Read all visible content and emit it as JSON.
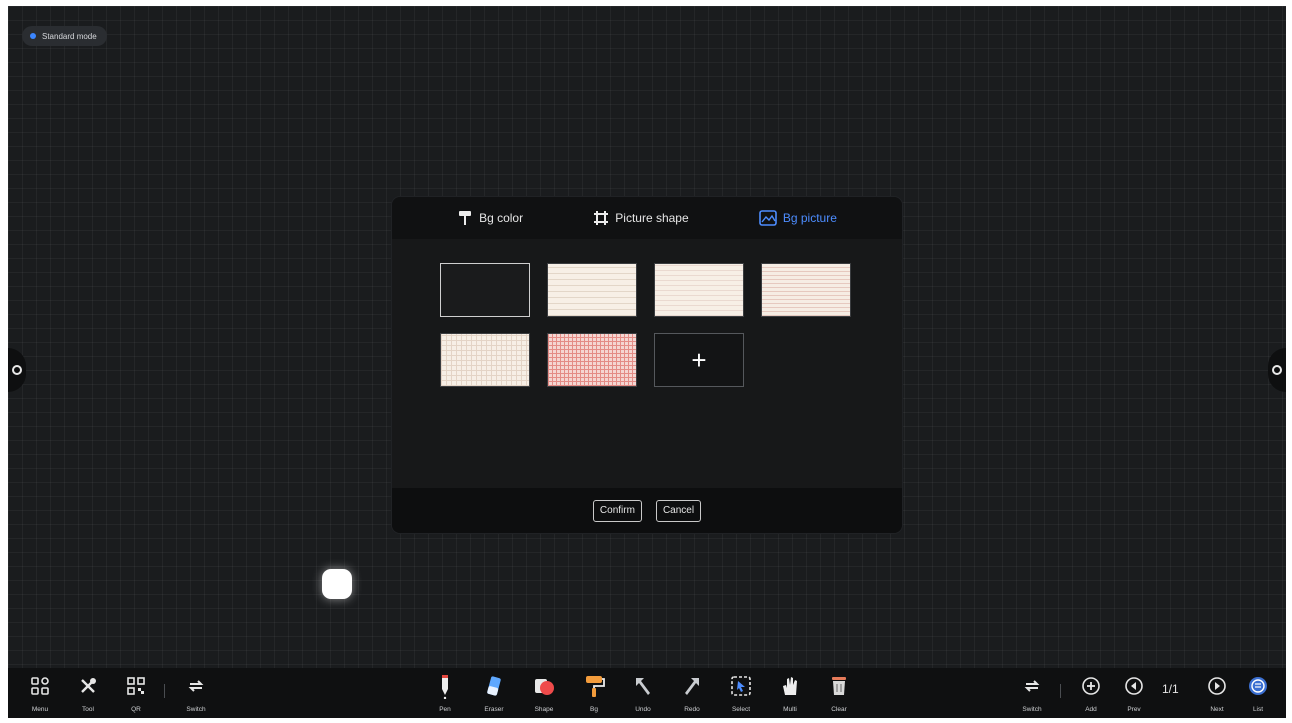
{
  "mode": {
    "label": "Standard mode"
  },
  "dialog": {
    "tabs": [
      {
        "label": "Bg color",
        "icon": "paint-roller-icon",
        "active": false
      },
      {
        "label": "Picture shape",
        "icon": "crop-frame-icon",
        "active": false
      },
      {
        "label": "Bg picture",
        "icon": "image-icon",
        "active": true
      }
    ],
    "backgrounds": [
      {
        "name": "dark-plain",
        "selected": true
      },
      {
        "name": "beige-lined",
        "selected": false
      },
      {
        "name": "beige-lined-fine",
        "selected": false
      },
      {
        "name": "beige-lined-red",
        "selected": false
      },
      {
        "name": "beige-grid",
        "selected": false
      },
      {
        "name": "pink-grid",
        "selected": false
      }
    ],
    "add_symbol": "+",
    "confirm_label": "Confirm",
    "cancel_label": "Cancel"
  },
  "toolbar": {
    "left": [
      {
        "label": "Menu",
        "icon": "menu-grid-icon"
      },
      {
        "label": "Tool",
        "icon": "tools-icon"
      },
      {
        "label": "QR",
        "icon": "qr-code-icon"
      },
      {
        "label": "Switch",
        "icon": "switch-icon"
      }
    ],
    "center": [
      {
        "label": "Pen",
        "icon": "pen-icon"
      },
      {
        "label": "Eraser",
        "icon": "eraser-icon"
      },
      {
        "label": "Shape",
        "icon": "shape-icon"
      },
      {
        "label": "Bg",
        "icon": "paint-roller-icon"
      },
      {
        "label": "Undo",
        "icon": "undo-icon"
      },
      {
        "label": "Redo",
        "icon": "redo-icon"
      },
      {
        "label": "Select",
        "icon": "select-icon"
      },
      {
        "label": "Multi",
        "icon": "multi-touch-icon"
      },
      {
        "label": "Clear",
        "icon": "trash-icon"
      }
    ],
    "right": [
      {
        "label": "Switch",
        "icon": "switch-icon"
      },
      {
        "label": "Add",
        "icon": "plus-circle-icon"
      },
      {
        "label": "Prev",
        "icon": "prev-circle-icon"
      },
      {
        "label": "Next",
        "icon": "next-circle-icon"
      },
      {
        "label": "List",
        "icon": "list-circle-icon"
      }
    ],
    "page_indicator": "1/1"
  },
  "colors": {
    "board": "#1a1c1e",
    "accent": "#4d8dff",
    "toolbar": "#0f1011"
  }
}
